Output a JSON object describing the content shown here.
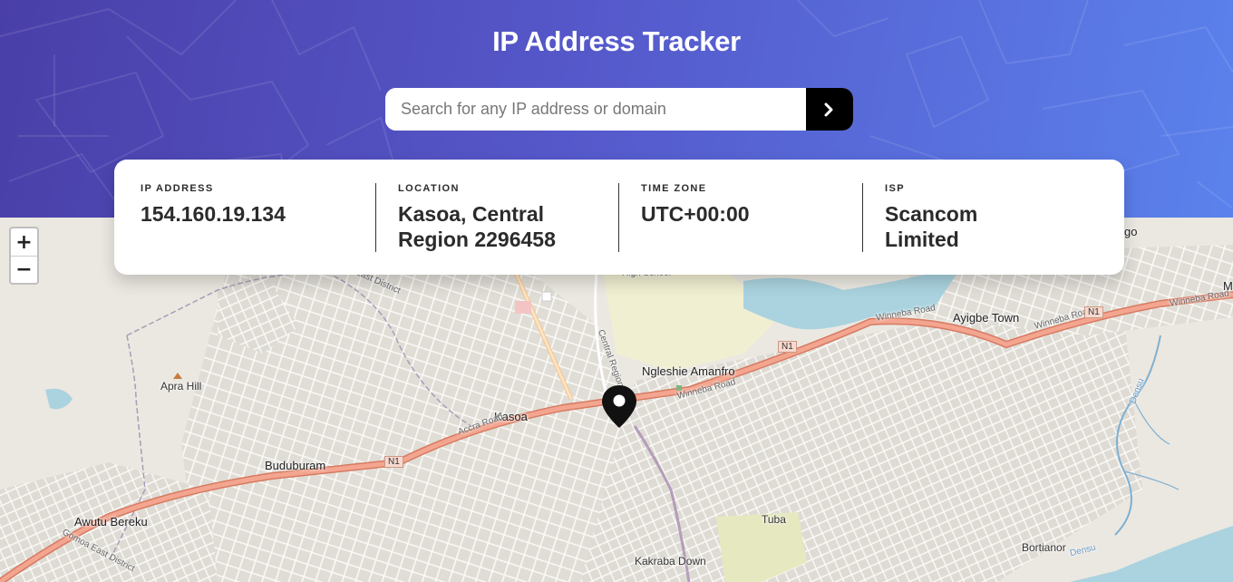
{
  "header": {
    "title": "IP Address Tracker"
  },
  "search": {
    "placeholder": "Search for any IP address or domain",
    "value": "",
    "submit_icon": "chevron-right-icon"
  },
  "info": {
    "ip": {
      "label": "IP ADDRESS",
      "value": "154.160.19.134"
    },
    "location": {
      "label": "LOCATION",
      "line1": "Kasoa, Central",
      "line2": "Region 2296458"
    },
    "timezone": {
      "label": "TIME ZONE",
      "value": "UTC+00:00"
    },
    "isp": {
      "label": "ISP",
      "line1": "Scancom",
      "line2": "Limited"
    }
  },
  "map": {
    "zoom_in": "+",
    "zoom_out": "−",
    "labels": {
      "apra_hill": "Apra Hill",
      "kasoa": "Kasoa",
      "ngleshie": "Ngleshie Amanfro",
      "ayigbe": "Ayigbe Town",
      "buduburam": "Buduburam",
      "awutu": "Awutu Bereku",
      "tuba": "Tuba",
      "kakraba": "Kakraba Down",
      "bortianor": "Bortianor",
      "high_school": "High School",
      "accra_road": "Accra Road",
      "winneba_road_1": "Winneba Road",
      "winneba_road_2": "Winneba Road",
      "winneba_road_3": "Winneba Road",
      "winneba_road_4": "Winneba Road",
      "n1_a": "N1",
      "n1_b": "N1",
      "n1_c": "N1",
      "gomoa_east_1": "Gomoa East District",
      "gomoa_east_2": "Gomoa East District",
      "central_region": "Central Region",
      "densu_1": "Densu",
      "densu_2": "Densu",
      "edge_go": "go",
      "edge_m": "M"
    },
    "marker_icon": "location-pin-icon"
  },
  "colors": {
    "header_start": "#4a3fa8",
    "header_end": "#5b82ec",
    "primary_road": "#e8927c",
    "water": "#aad3df",
    "text_dark": "#2b2b2b"
  }
}
